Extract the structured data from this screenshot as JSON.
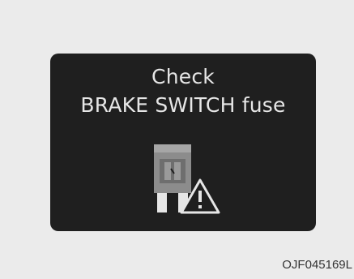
{
  "display": {
    "line1": "Check",
    "line2": "BRAKE SWITCH fuse"
  },
  "icons": {
    "fuse": "fuse-icon",
    "warning": "warning-triangle-icon"
  },
  "colors": {
    "background": "#ebebeb",
    "panel": "#1f1f1f",
    "text": "#e6e6e6",
    "icon": "#e6e6e6"
  },
  "figure_code": "OJF045169L"
}
